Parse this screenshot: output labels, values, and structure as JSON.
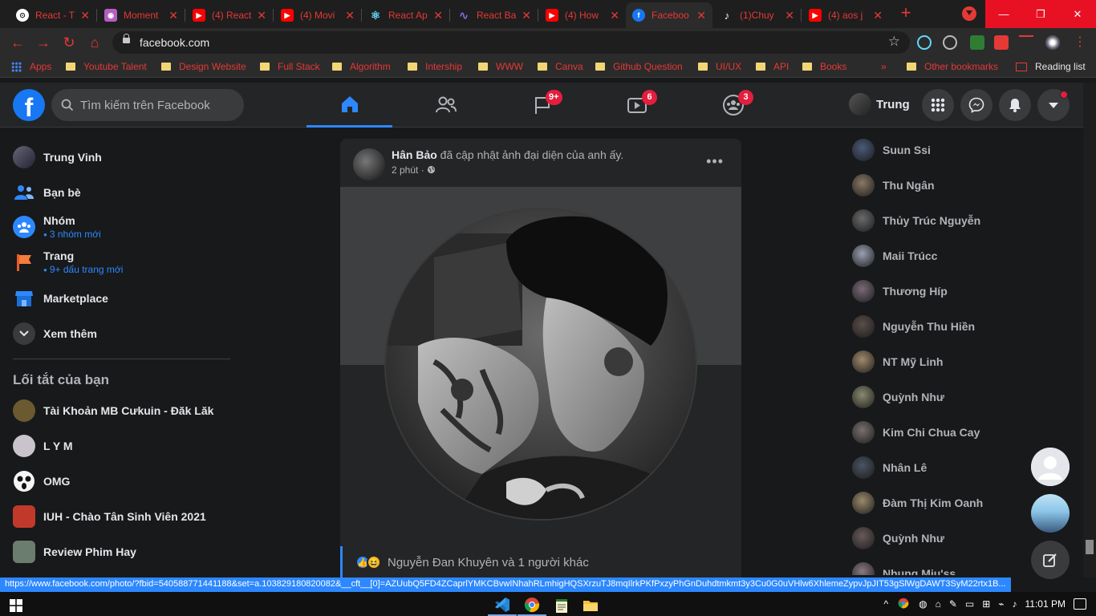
{
  "browser": {
    "tabs": [
      {
        "title": "React - T",
        "favicon": "react-icon",
        "color": "#ffffff"
      },
      {
        "title": "Moment",
        "favicon": "moment-icon",
        "color": "#b35ec2"
      },
      {
        "title": "(4) React",
        "favicon": "youtube-icon",
        "color": "#ff0000"
      },
      {
        "title": "(4) Movi",
        "favicon": "youtube-icon",
        "color": "#ff0000"
      },
      {
        "title": "React Ap",
        "favicon": "react-icon",
        "color": "#61dafb"
      },
      {
        "title": "React Ba",
        "favicon": "redux-icon",
        "color": "#7c6bd6"
      },
      {
        "title": "(4) How",
        "favicon": "youtube-icon",
        "color": "#ff0000"
      },
      {
        "title": "Faceboo",
        "favicon": "facebook-icon",
        "color": "#1877f2"
      },
      {
        "title": "(1)Chuy",
        "favicon": "tiktok-icon",
        "color": "#000000"
      },
      {
        "title": "(4) aos j",
        "favicon": "youtube-icon",
        "color": "#ff0000"
      }
    ],
    "new_tab": "+",
    "window_controls": {
      "minimize": "—",
      "restore": "❐",
      "close": "✕"
    },
    "nav": {
      "back": "←",
      "forward": "→",
      "reload": "↻",
      "home": "⌂"
    },
    "url": "facebook.com",
    "bookmark_star": "☆",
    "bookmarks": [
      "Apps",
      "Youtube Talent",
      "Design Website",
      "Full Stack",
      "Algorithm",
      "Intership",
      "WWW",
      "Canva",
      "Github Question",
      "UI/UX",
      "API",
      "Books"
    ],
    "more_bookmarks": "»",
    "other_bookmarks": "Other bookmarks",
    "reading_list": "Reading list"
  },
  "facebook": {
    "logo": "f",
    "search_placeholder": "Tìm kiếm trên Facebook",
    "nav_badges": {
      "pages": "9+",
      "watch": "6",
      "groups": "3"
    },
    "profile_name": "Trung",
    "left_nav": [
      {
        "label": "Trung Vinh",
        "sub": ""
      },
      {
        "label": "Bạn bè",
        "sub": ""
      },
      {
        "label": "Nhóm",
        "sub": "3 nhóm mới"
      },
      {
        "label": "Trang",
        "sub": "9+ dấu trang mới"
      },
      {
        "label": "Marketplace",
        "sub": ""
      },
      {
        "label": "Xem thêm",
        "sub": ""
      }
    ],
    "shortcuts_title": "Lối tắt của bạn",
    "shortcuts": [
      {
        "label": "Tài Khoản MB Cưkuin - Đăk Lăk",
        "color": "#6b5a2f"
      },
      {
        "label": "L Y M",
        "color": "#c9c3cc"
      },
      {
        "label": "OMG",
        "color": "#f5f5f5"
      },
      {
        "label": "IUH - Chào Tân Sinh Viên 2021",
        "color": "#c0392b"
      },
      {
        "label": "Review Phim Hay",
        "color": "#6a7d6e"
      }
    ],
    "post": {
      "author": "Hân Bảo",
      "action": " đã cập nhật ảnh đại diện của anh ấy.",
      "time": "2 phút · ",
      "more": "•••",
      "reactions_text": "Nguyễn Đan Khuyên và 1 người khác"
    },
    "contacts": [
      {
        "name": "Suun Ssi",
        "color": "#4a5a78"
      },
      {
        "name": "Thu Ngân",
        "color": "#8a7864"
      },
      {
        "name": "Thủy Trúc Nguyễn",
        "color": "#6a6a6a"
      },
      {
        "name": "Maii Trúcc",
        "color": "#9aa0b4"
      },
      {
        "name": "Thương Híp",
        "color": "#7a6a78"
      },
      {
        "name": "Nguyễn Thu Hiền",
        "color": "#5a4e48"
      },
      {
        "name": "NT Mỹ Linh",
        "color": "#a08a6c"
      },
      {
        "name": "Quỳnh Như",
        "color": "#8a8a70"
      },
      {
        "name": "Kim Chi Chua Cay",
        "color": "#7a7070"
      },
      {
        "name": "Nhân Lê",
        "color": "#4a5464"
      },
      {
        "name": "Đàm Thị Kim Oanh",
        "color": "#9a8a6a"
      },
      {
        "name": "Quỳnh Như",
        "color": "#6a5a5a"
      },
      {
        "name": "Nhung Miu'ss",
        "color": "#8a7a80"
      }
    ]
  },
  "status_url": "https://www.facebook.com/photo/?fbid=540588771441188&set=a.103829180820082&__cft__[0]=AZUubQ5FD4ZCaprlYMKCBvwINhahRLmhigHQSXrzuTJ8mqIlrkPKfPxzyPhGnDuhdtmkmt3y3Cu0G0uVHlw6XhlemeZypvJpJIT53gSlWgDAWT3SyM22rtx1B...",
  "taskbar": {
    "clock": "11:01 PM",
    "tray": [
      "^",
      "◍",
      "⌂",
      "✎",
      "▭",
      "⊞",
      "⌁",
      "♪"
    ]
  }
}
